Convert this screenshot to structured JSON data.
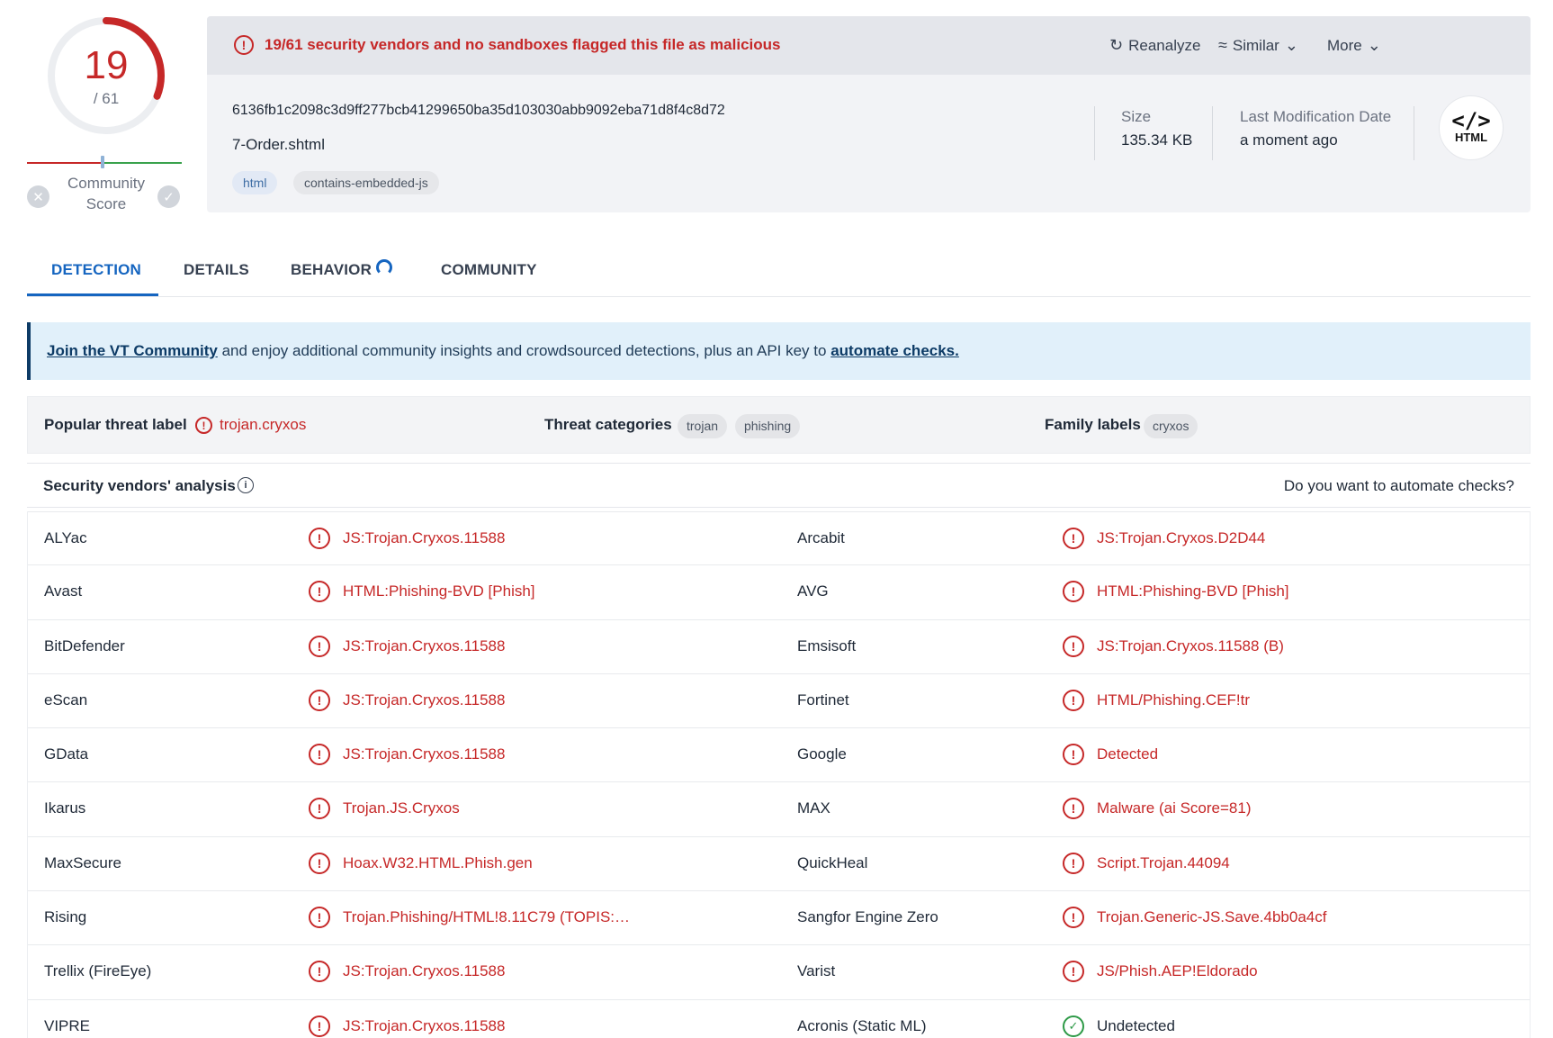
{
  "score": {
    "detections": "19",
    "total": "/ 61",
    "detection_ratio": 0.311,
    "community_label": "Community Score",
    "vote_down_icon": "close-icon",
    "vote_up_icon": "check-icon"
  },
  "header": {
    "alert": "19/61 security vendors and no sandboxes flagged this file as malicious",
    "actions": {
      "reanalyze": "Reanalyze",
      "similar": "Similar",
      "more": "More"
    },
    "hash": "6136fb1c2098c3d9ff277bcb41299650ba35d103030abb9092eba71d8f4c8d72",
    "filename": "7-Order.shtml",
    "tags": [
      "html",
      "contains-embedded-js"
    ],
    "size_label": "Size",
    "size_value": "135.34 KB",
    "date_label": "Last Modification Date",
    "date_value": "a moment ago",
    "type_code": "</>",
    "type_label": "HTML"
  },
  "tabs": [
    "DETECTION",
    "DETAILS",
    "BEHAVIOR",
    "COMMUNITY"
  ],
  "banner": {
    "link1": "Join the VT Community",
    "middle": " and enjoy additional community insights and crowdsourced detections, plus an API key to ",
    "link2": "automate checks."
  },
  "threat": {
    "popular_label_key": "Popular threat label",
    "popular_label_value": "trojan.cryxos",
    "categories_key": "Threat categories",
    "categories": [
      "trojan",
      "phishing"
    ],
    "family_key": "Family labels",
    "families": [
      "cryxos"
    ]
  },
  "vendors_header": {
    "title": "Security vendors' analysis",
    "automate": "Do you want to automate checks?"
  },
  "vendors": [
    {
      "left": {
        "name": "ALYac",
        "result": "JS:Trojan.Cryxos.11588",
        "status": "malicious"
      },
      "right": {
        "name": "Arcabit",
        "result": "JS:Trojan.Cryxos.D2D44",
        "status": "malicious"
      }
    },
    {
      "left": {
        "name": "Avast",
        "result": "HTML:Phishing-BVD [Phish]",
        "status": "malicious"
      },
      "right": {
        "name": "AVG",
        "result": "HTML:Phishing-BVD [Phish]",
        "status": "malicious"
      }
    },
    {
      "left": {
        "name": "BitDefender",
        "result": "JS:Trojan.Cryxos.11588",
        "status": "malicious"
      },
      "right": {
        "name": "Emsisoft",
        "result": "JS:Trojan.Cryxos.11588 (B)",
        "status": "malicious"
      }
    },
    {
      "left": {
        "name": "eScan",
        "result": "JS:Trojan.Cryxos.11588",
        "status": "malicious"
      },
      "right": {
        "name": "Fortinet",
        "result": "HTML/Phishing.CEF!tr",
        "status": "malicious"
      }
    },
    {
      "left": {
        "name": "GData",
        "result": "JS:Trojan.Cryxos.11588",
        "status": "malicious"
      },
      "right": {
        "name": "Google",
        "result": "Detected",
        "status": "malicious"
      }
    },
    {
      "left": {
        "name": "Ikarus",
        "result": "Trojan.JS.Cryxos",
        "status": "malicious"
      },
      "right": {
        "name": "MAX",
        "result": "Malware (ai Score=81)",
        "status": "malicious"
      }
    },
    {
      "left": {
        "name": "MaxSecure",
        "result": "Hoax.W32.HTML.Phish.gen",
        "status": "malicious"
      },
      "right": {
        "name": "QuickHeal",
        "result": "Script.Trojan.44094",
        "status": "malicious"
      }
    },
    {
      "left": {
        "name": "Rising",
        "result": "Trojan.Phishing/HTML!8.11C79 (TOPIS:E…",
        "status": "malicious"
      },
      "right": {
        "name": "Sangfor Engine Zero",
        "result": "Trojan.Generic-JS.Save.4bb0a4cf",
        "status": "malicious"
      }
    },
    {
      "left": {
        "name": "Trellix (FireEye)",
        "result": "JS:Trojan.Cryxos.11588",
        "status": "malicious"
      },
      "right": {
        "name": "Varist",
        "result": "JS/Phish.AEP!Eldorado",
        "status": "malicious"
      }
    },
    {
      "left": {
        "name": "VIPRE",
        "result": "JS:Trojan.Cryxos.11588",
        "status": "malicious"
      },
      "right": {
        "name": "Acronis (Static ML)",
        "result": "Undetected",
        "status": "undetected"
      }
    }
  ],
  "colors": {
    "malicious": "#c62828",
    "undetected_icon": "#2e9a47",
    "accent": "#1565c0",
    "banner_bg": "#e1f0fa"
  }
}
